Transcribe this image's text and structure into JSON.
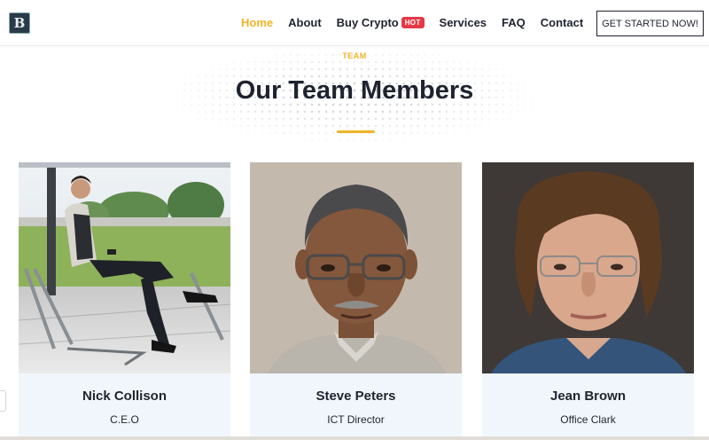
{
  "nav": {
    "logo_glyph": "B",
    "links": [
      "Home",
      "About",
      "Buy Crypto",
      "Services",
      "FAQ",
      "Contact"
    ],
    "hot_badge": "HOT",
    "cta": "GET STARTED NOW!"
  },
  "section": {
    "eyebrow": "TEAM",
    "title": "Our Team Members"
  },
  "team": [
    {
      "name": "Nick Collison",
      "role": "C.E.O"
    },
    {
      "name": "Steve Peters",
      "role": "ICT Director"
    },
    {
      "name": "Jean Brown",
      "role": "Office Clark"
    }
  ],
  "colors": {
    "accent": "#f0b429",
    "hot": "#e53946",
    "card_bg": "#f1f6fc",
    "text": "#1f2330"
  }
}
